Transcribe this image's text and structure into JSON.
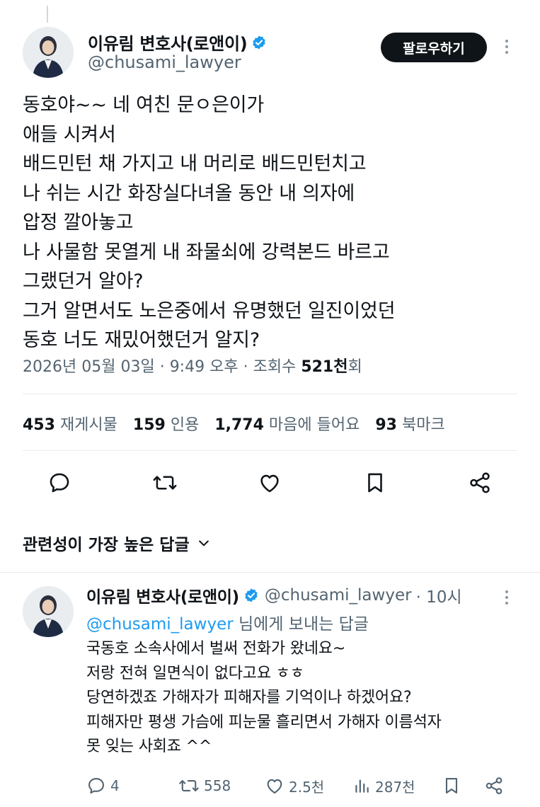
{
  "tweet": {
    "author": {
      "name": "이유림 변호사(로앤이)",
      "handle": "@chusami_lawyer"
    },
    "follow_label": "팔로우하기",
    "text_lines": [
      "동호야~~ 네 여친 문ㅇ은이가",
      "애들 시켜서",
      "배드민턴 채 가지고 내 머리로 배드민턴치고",
      "나 쉬는 시간 화장실다녀올 동안 내 의자에",
      "압정 깔아놓고",
      "나 사물함 못열게 내 좌물쇠에 강력본드 바르고",
      "그랬던거 알아?",
      "그거 알면서도 노은중에서 유명했던 일진이었던",
      "동호 너도 재밌어했던거 알지?"
    ],
    "meta": {
      "date": "2026년 05월 03일",
      "time": "9:49 오후",
      "views_prefix": "조회수",
      "views_count": "521천",
      "views_suffix": "회"
    },
    "stats": {
      "retweets_count": "453",
      "retweets_label": "재게시물",
      "quotes_count": "159",
      "quotes_label": "인용",
      "likes_count": "1,774",
      "likes_label": "마음에 들어요",
      "bookmarks_count": "93",
      "bookmarks_label": "북마크"
    },
    "actions": [
      "reply",
      "retweet",
      "like",
      "bookmark",
      "share"
    ]
  },
  "replies_sort": {
    "label": "관련성이 가장 높은 답글"
  },
  "reply": {
    "author": {
      "name": "이유림 변호사(로앤이)",
      "handle": "@chusami_lawyer",
      "time": "· 10시"
    },
    "replying_to_handle": "@chusami_lawyer",
    "replying_suffix": "님에게 보내는 답글",
    "text_lines": [
      "국동호 소속사에서 벌써 전화가 왔네요~",
      "저랑 전혀 일면식이 없다고요 ㅎㅎ",
      "당연하겠죠 가해자가 피해자를 기억이나 하겠어요?",
      "피해자만 평생 가슴에 피눈물 흘리면서 가해자 이름석자",
      "못 잊는 사회죠 ^^"
    ],
    "actions": {
      "replies": "4",
      "retweets": "558",
      "likes": "2.5천",
      "views": "287천"
    }
  },
  "colors": {
    "text": "#0f1419",
    "secondary": "#536471",
    "link": "#1d9bf0",
    "verified": "#1d9bf0",
    "divider": "#e6ecf0"
  }
}
